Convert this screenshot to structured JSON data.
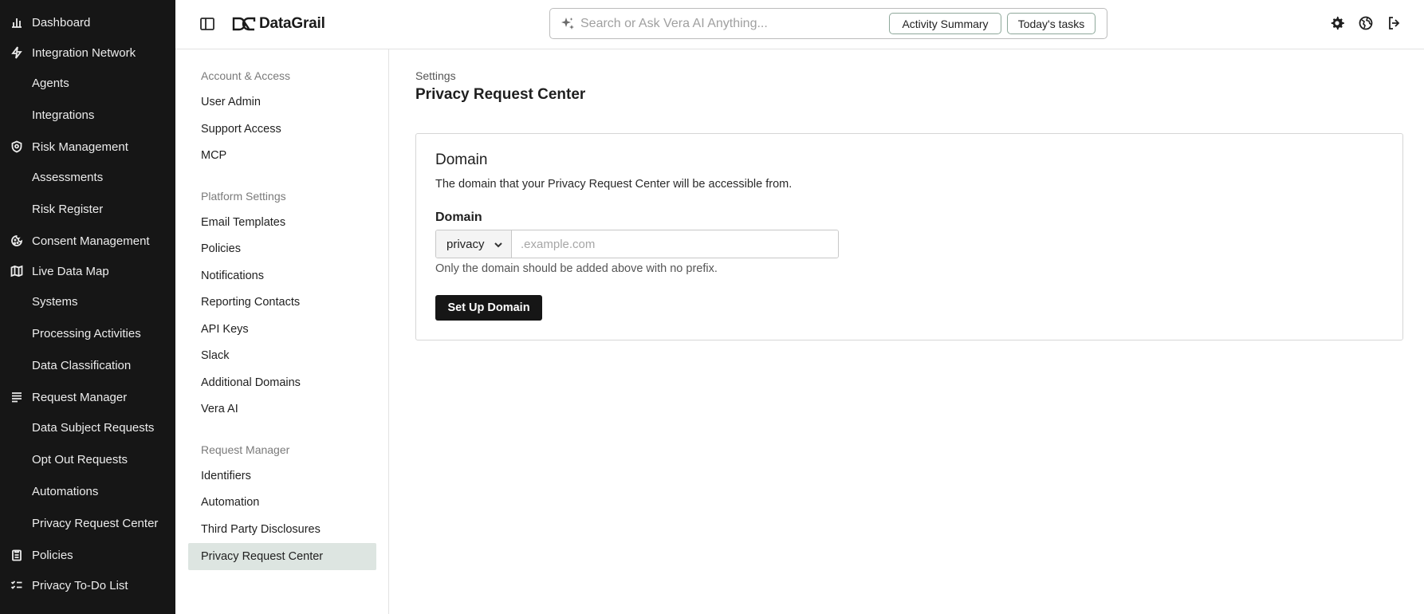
{
  "nav": {
    "items": [
      {
        "label": "Dashboard",
        "icon": "chart-bar-icon"
      },
      {
        "label": "Integration Network",
        "icon": "bolt-icon"
      },
      {
        "label": "Agents",
        "icon": ""
      },
      {
        "label": "Integrations",
        "icon": ""
      },
      {
        "label": "Risk Management",
        "icon": "risk-shield-icon"
      },
      {
        "label": "Assessments",
        "icon": ""
      },
      {
        "label": "Risk Register",
        "icon": ""
      },
      {
        "label": "Consent Management",
        "icon": "cookie-icon"
      },
      {
        "label": "Live Data Map",
        "icon": "map-icon"
      },
      {
        "label": "Systems",
        "icon": ""
      },
      {
        "label": "Processing Activities",
        "icon": ""
      },
      {
        "label": "Data Classification",
        "icon": ""
      },
      {
        "label": "Request Manager",
        "icon": "list-lines-icon"
      },
      {
        "label": "Data Subject Requests",
        "icon": ""
      },
      {
        "label": "Opt Out Requests",
        "icon": ""
      },
      {
        "label": "Automations",
        "icon": ""
      },
      {
        "label": "Privacy Request Center",
        "icon": ""
      },
      {
        "label": "Policies",
        "icon": "clipboard-icon"
      },
      {
        "label": "Privacy To-Do List",
        "icon": "checklist-icon"
      }
    ]
  },
  "header": {
    "logo_text": "DataGrail",
    "search_placeholder": "Search or Ask Vera AI Anything...",
    "pill_activity": "Activity Summary",
    "pill_tasks": "Today's tasks"
  },
  "settings": {
    "sections": [
      {
        "heading": "Account & Access",
        "items": [
          "User Admin",
          "Support Access",
          "MCP"
        ]
      },
      {
        "heading": "Platform Settings",
        "items": [
          "Email Templates",
          "Policies",
          "Notifications",
          "Reporting Contacts",
          "API Keys",
          "Slack",
          "Additional Domains",
          "Vera AI"
        ]
      },
      {
        "heading": "Request Manager",
        "items": [
          "Identifiers",
          "Automation",
          "Third Party Disclosures",
          "Privacy Request Center"
        ]
      }
    ],
    "active_item": "Privacy Request Center"
  },
  "main": {
    "breadcrumb": "Settings",
    "title": "Privacy Request Center",
    "card": {
      "title": "Domain",
      "description": "The domain that your Privacy Request Center will be accessible from.",
      "field_label": "Domain",
      "prefix_value": "privacy",
      "domain_placeholder": ".example.com",
      "help_text": "Only the domain should be added above with no prefix.",
      "button_label": "Set Up Domain"
    }
  },
  "colors": {
    "nav_bg": "#161616",
    "active_bg": "#dde5e1",
    "pill_border": "#8ea89a",
    "primary_button": "#161616"
  }
}
